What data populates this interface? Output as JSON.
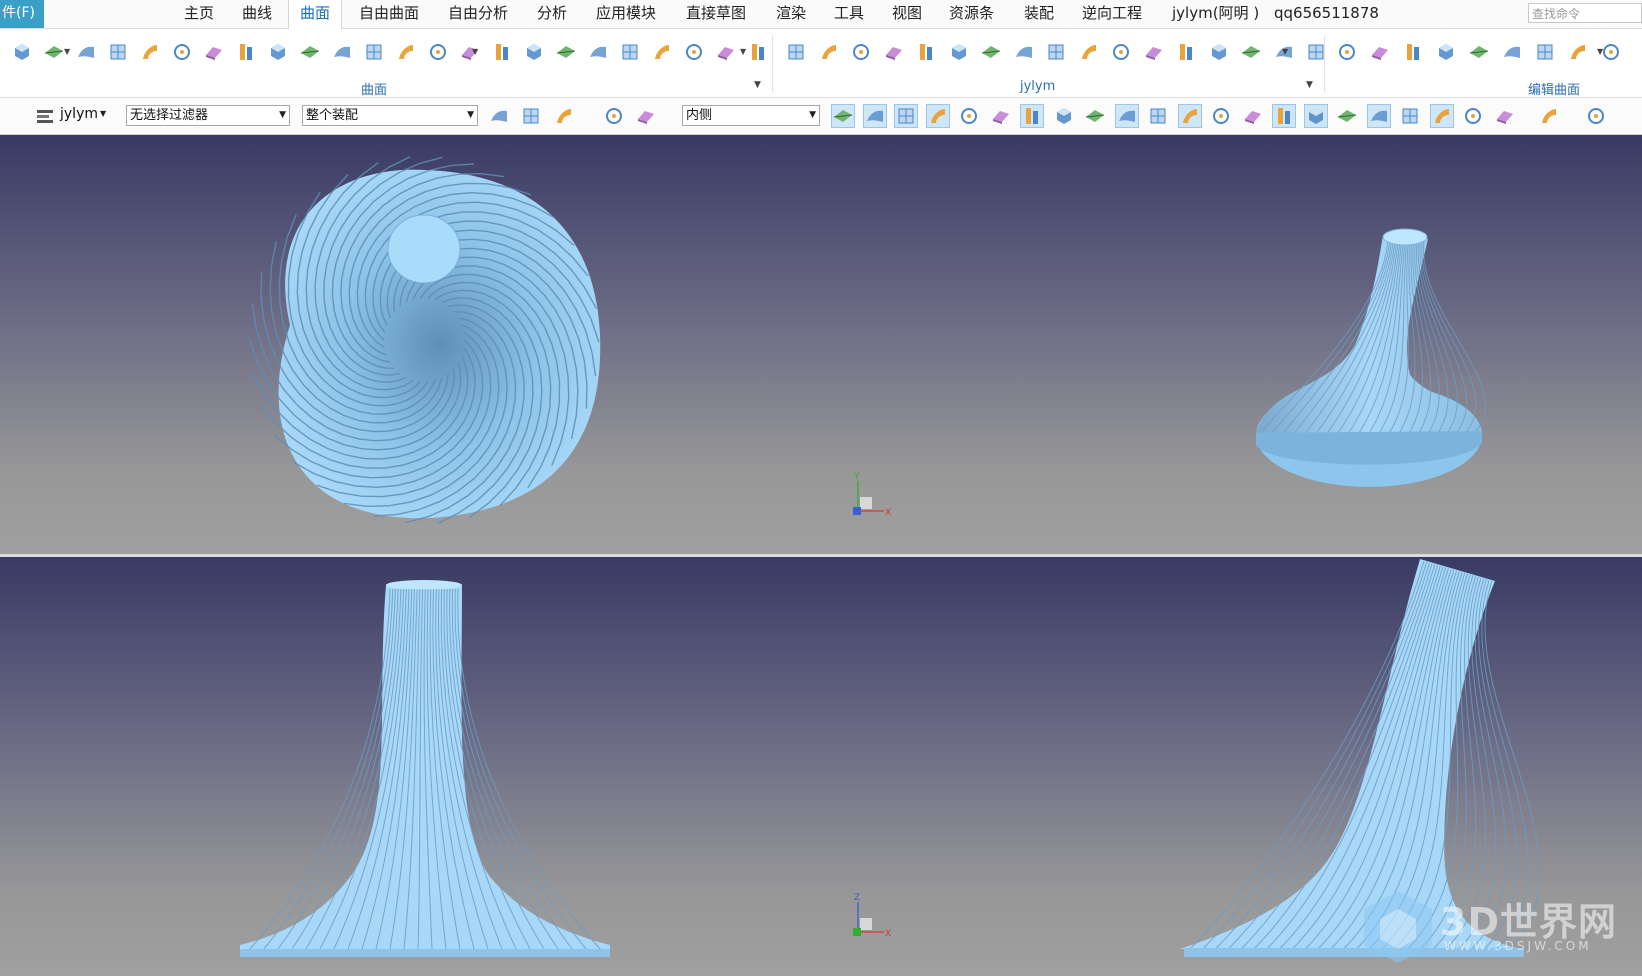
{
  "menubar": {
    "file_tab": "件(F)",
    "tabs": [
      {
        "label": "主页",
        "active": false
      },
      {
        "label": "曲线",
        "active": false
      },
      {
        "label": "曲面",
        "active": true
      },
      {
        "label": "自由曲面",
        "active": false
      },
      {
        "label": "自由分析",
        "active": false
      },
      {
        "label": "分析",
        "active": false
      },
      {
        "label": "应用模块",
        "active": false
      },
      {
        "label": "直接草图",
        "active": false
      },
      {
        "label": "渲染",
        "active": false
      },
      {
        "label": "工具",
        "active": false
      },
      {
        "label": "视图",
        "active": false
      },
      {
        "label": "资源条",
        "active": false
      },
      {
        "label": "装配",
        "active": false
      },
      {
        "label": "逆向工程",
        "active": false
      },
      {
        "label": "jylym(阿明 )",
        "active": false
      },
      {
        "label": "qq656511878",
        "active": false
      }
    ],
    "search_placeholder": "查找命令"
  },
  "ribbon": {
    "groups": [
      {
        "label": "曲面"
      },
      {
        "label": "jylym"
      },
      {
        "label": "编辑曲面"
      }
    ],
    "icon_color_main": "#4a86c8",
    "icon_color_accent": "#e8a33a"
  },
  "toolbar2": {
    "user_menu": "jylym",
    "filter_combo": "无选择过滤器",
    "scope_combo": "整个装配",
    "side_combo": "内侧"
  },
  "viewports": {
    "background_top": "#393a64",
    "background_bottom": "#a0a0a0",
    "model_color": "#a8d8f8",
    "axis_x": "X",
    "axis_y": "Y",
    "axis_z": "Z"
  },
  "watermark": {
    "brand": "3D世界网",
    "url": "WWW.3DSJW.COM"
  }
}
